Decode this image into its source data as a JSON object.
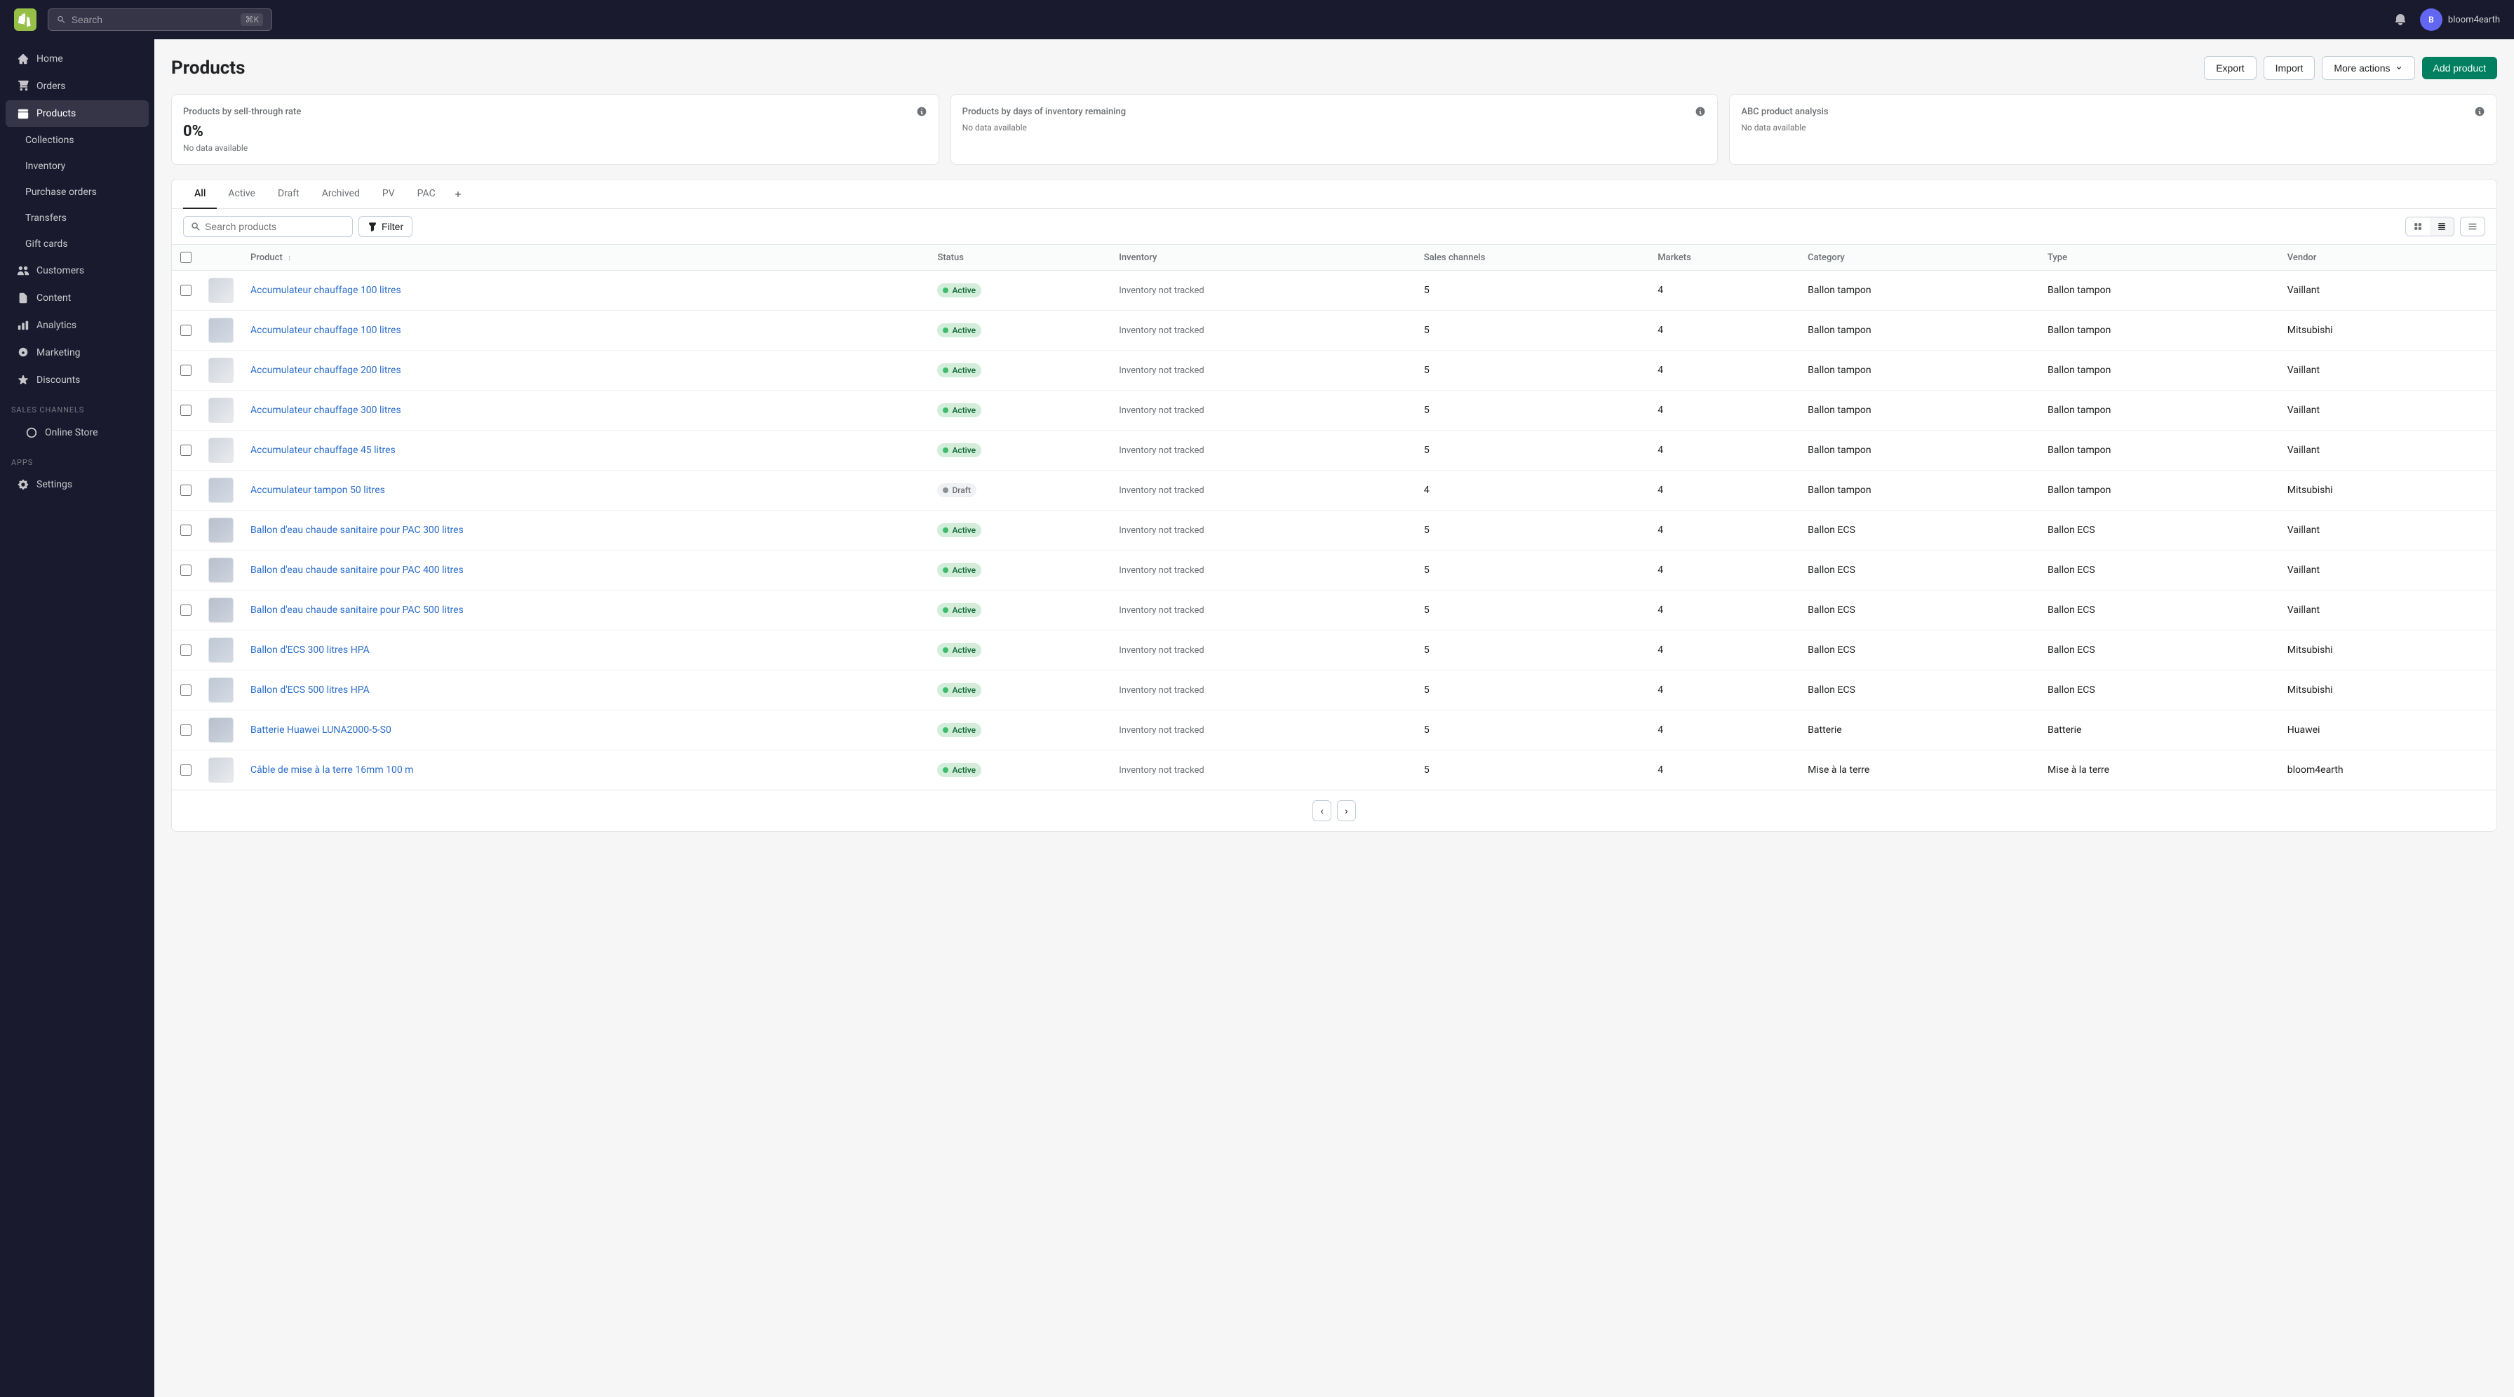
{
  "app": {
    "name": "Shopify",
    "store_name": "bloom4earth",
    "store_initial": "B",
    "search_placeholder": "Search",
    "search_shortcut": "⌘K"
  },
  "sidebar": {
    "items": [
      {
        "id": "home",
        "label": "Home",
        "icon": "home"
      },
      {
        "id": "orders",
        "label": "Orders",
        "icon": "orders"
      },
      {
        "id": "products",
        "label": "Products",
        "icon": "products",
        "active": true
      },
      {
        "id": "collections",
        "label": "Collections",
        "icon": "collections",
        "sub": true
      },
      {
        "id": "inventory",
        "label": "Inventory",
        "icon": "inventory",
        "sub": true
      },
      {
        "id": "purchase-orders",
        "label": "Purchase orders",
        "icon": "purchase-orders",
        "sub": true
      },
      {
        "id": "transfers",
        "label": "Transfers",
        "icon": "transfers",
        "sub": true
      },
      {
        "id": "gift-cards",
        "label": "Gift cards",
        "icon": "gift-cards",
        "sub": true
      },
      {
        "id": "customers",
        "label": "Customers",
        "icon": "customers"
      },
      {
        "id": "content",
        "label": "Content",
        "icon": "content"
      },
      {
        "id": "analytics",
        "label": "Analytics",
        "icon": "analytics"
      },
      {
        "id": "marketing",
        "label": "Marketing",
        "icon": "marketing"
      },
      {
        "id": "discounts",
        "label": "Discounts",
        "icon": "discounts"
      },
      {
        "id": "sales-channels",
        "label": "Sales channels",
        "icon": "sales-channels",
        "section": true
      },
      {
        "id": "online-store",
        "label": "Online Store",
        "icon": "online-store",
        "sub": true
      },
      {
        "id": "apps",
        "label": "Apps",
        "icon": "apps",
        "section": true
      },
      {
        "id": "settings",
        "label": "Settings",
        "icon": "settings",
        "bottom": true
      }
    ]
  },
  "page": {
    "title": "Products",
    "actions": {
      "export_label": "Export",
      "import_label": "Import",
      "more_actions_label": "More actions",
      "add_product_label": "Add product"
    }
  },
  "analytics_cards": [
    {
      "title": "Products by sell-through rate",
      "value": "0%",
      "sub": "No data available",
      "has_info": true
    },
    {
      "title": "Products by days of inventory remaining",
      "value": "",
      "sub": "No data available",
      "has_info": true
    },
    {
      "title": "ABC product analysis",
      "value": "",
      "sub": "No data available",
      "has_info": true
    }
  ],
  "tabs": [
    {
      "id": "all",
      "label": "All",
      "active": true
    },
    {
      "id": "active",
      "label": "Active"
    },
    {
      "id": "draft",
      "label": "Draft"
    },
    {
      "id": "archived",
      "label": "Archived"
    },
    {
      "id": "pv",
      "label": "PV"
    },
    {
      "id": "pac",
      "label": "PAC"
    }
  ],
  "table": {
    "columns": [
      {
        "id": "product",
        "label": "Product",
        "sortable": true
      },
      {
        "id": "status",
        "label": "Status"
      },
      {
        "id": "inventory",
        "label": "Inventory"
      },
      {
        "id": "sales_channels",
        "label": "Sales channels"
      },
      {
        "id": "markets",
        "label": "Markets"
      },
      {
        "id": "category",
        "label": "Category"
      },
      {
        "id": "type",
        "label": "Type"
      },
      {
        "id": "vendor",
        "label": "Vendor"
      }
    ],
    "rows": [
      {
        "id": 1,
        "name": "Accumulateur chauffage 100 litres",
        "status": "Active",
        "status_type": "active",
        "inventory": "Inventory not tracked",
        "sales_channels": 5,
        "markets": 4,
        "category": "Ballon tampon",
        "type": "Ballon tampon",
        "vendor": "Vaillant",
        "thumb": "a"
      },
      {
        "id": 2,
        "name": "Accumulateur chauffage 100 litres",
        "status": "Active",
        "status_type": "active",
        "inventory": "Inventory not tracked",
        "sales_channels": 5,
        "markets": 4,
        "category": "Ballon tampon",
        "type": "Ballon tampon",
        "vendor": "Mitsubishi",
        "thumb": "b"
      },
      {
        "id": 3,
        "name": "Accumulateur chauffage 200 litres",
        "status": "Active",
        "status_type": "active",
        "inventory": "Inventory not tracked",
        "sales_channels": 5,
        "markets": 4,
        "category": "Ballon tampon",
        "type": "Ballon tampon",
        "vendor": "Vaillant",
        "thumb": "a"
      },
      {
        "id": 4,
        "name": "Accumulateur chauffage 300 litres",
        "status": "Active",
        "status_type": "active",
        "inventory": "Inventory not tracked",
        "sales_channels": 5,
        "markets": 4,
        "category": "Ballon tampon",
        "type": "Ballon tampon",
        "vendor": "Vaillant",
        "thumb": "a"
      },
      {
        "id": 5,
        "name": "Accumulateur chauffage 45 litres",
        "status": "Active",
        "status_type": "active",
        "inventory": "Inventory not tracked",
        "sales_channels": 5,
        "markets": 4,
        "category": "Ballon tampon",
        "type": "Ballon tampon",
        "vendor": "Vaillant",
        "thumb": "a"
      },
      {
        "id": 6,
        "name": "Accumulateur tampon 50 litres",
        "status": "Draft",
        "status_type": "draft",
        "inventory": "Inventory not tracked",
        "sales_channels": 4,
        "markets": 4,
        "category": "Ballon tampon",
        "type": "Ballon tampon",
        "vendor": "Mitsubishi",
        "thumb": "b"
      },
      {
        "id": 7,
        "name": "Ballon d'eau chaude sanitaire pour PAC 300 litres",
        "status": "Active",
        "status_type": "active",
        "inventory": "Inventory not tracked",
        "sales_channels": 5,
        "markets": 4,
        "category": "Ballon ECS",
        "type": "Ballon ECS",
        "vendor": "Vaillant",
        "thumb": "c"
      },
      {
        "id": 8,
        "name": "Ballon d'eau chaude sanitaire pour PAC 400 litres",
        "status": "Active",
        "status_type": "active",
        "inventory": "Inventory not tracked",
        "sales_channels": 5,
        "markets": 4,
        "category": "Ballon ECS",
        "type": "Ballon ECS",
        "vendor": "Vaillant",
        "thumb": "c"
      },
      {
        "id": 9,
        "name": "Ballon d'eau chaude sanitaire pour PAC 500 litres",
        "status": "Active",
        "status_type": "active",
        "inventory": "Inventory not tracked",
        "sales_channels": 5,
        "markets": 4,
        "category": "Ballon ECS",
        "type": "Ballon ECS",
        "vendor": "Vaillant",
        "thumb": "c"
      },
      {
        "id": 10,
        "name": "Ballon d'ECS 300 litres HPA",
        "status": "Active",
        "status_type": "active",
        "inventory": "Inventory not tracked",
        "sales_channels": 5,
        "markets": 4,
        "category": "Ballon ECS",
        "type": "Ballon ECS",
        "vendor": "Mitsubishi",
        "thumb": "b"
      },
      {
        "id": 11,
        "name": "Ballon d'ECS 500 litres HPA",
        "status": "Active",
        "status_type": "active",
        "inventory": "Inventory not tracked",
        "sales_channels": 5,
        "markets": 4,
        "category": "Ballon ECS",
        "type": "Ballon ECS",
        "vendor": "Mitsubishi",
        "thumb": "b"
      },
      {
        "id": 12,
        "name": "Batterie Huawei LUNA2000-5-S0",
        "status": "Active",
        "status_type": "active",
        "inventory": "Inventory not tracked",
        "sales_channels": 5,
        "markets": 4,
        "category": "Batterie",
        "type": "Batterie",
        "vendor": "Huawei",
        "thumb": "c"
      },
      {
        "id": 13,
        "name": "Câble de mise à la terre 16mm 100 m",
        "status": "Active",
        "status_type": "active",
        "inventory": "Inventory not tracked",
        "sales_channels": 5,
        "markets": 4,
        "category": "Mise à la terre",
        "type": "Mise à la terre",
        "vendor": "bloom4earth",
        "thumb": "a"
      }
    ]
  },
  "pagination": {
    "prev_label": "‹",
    "next_label": "›"
  }
}
